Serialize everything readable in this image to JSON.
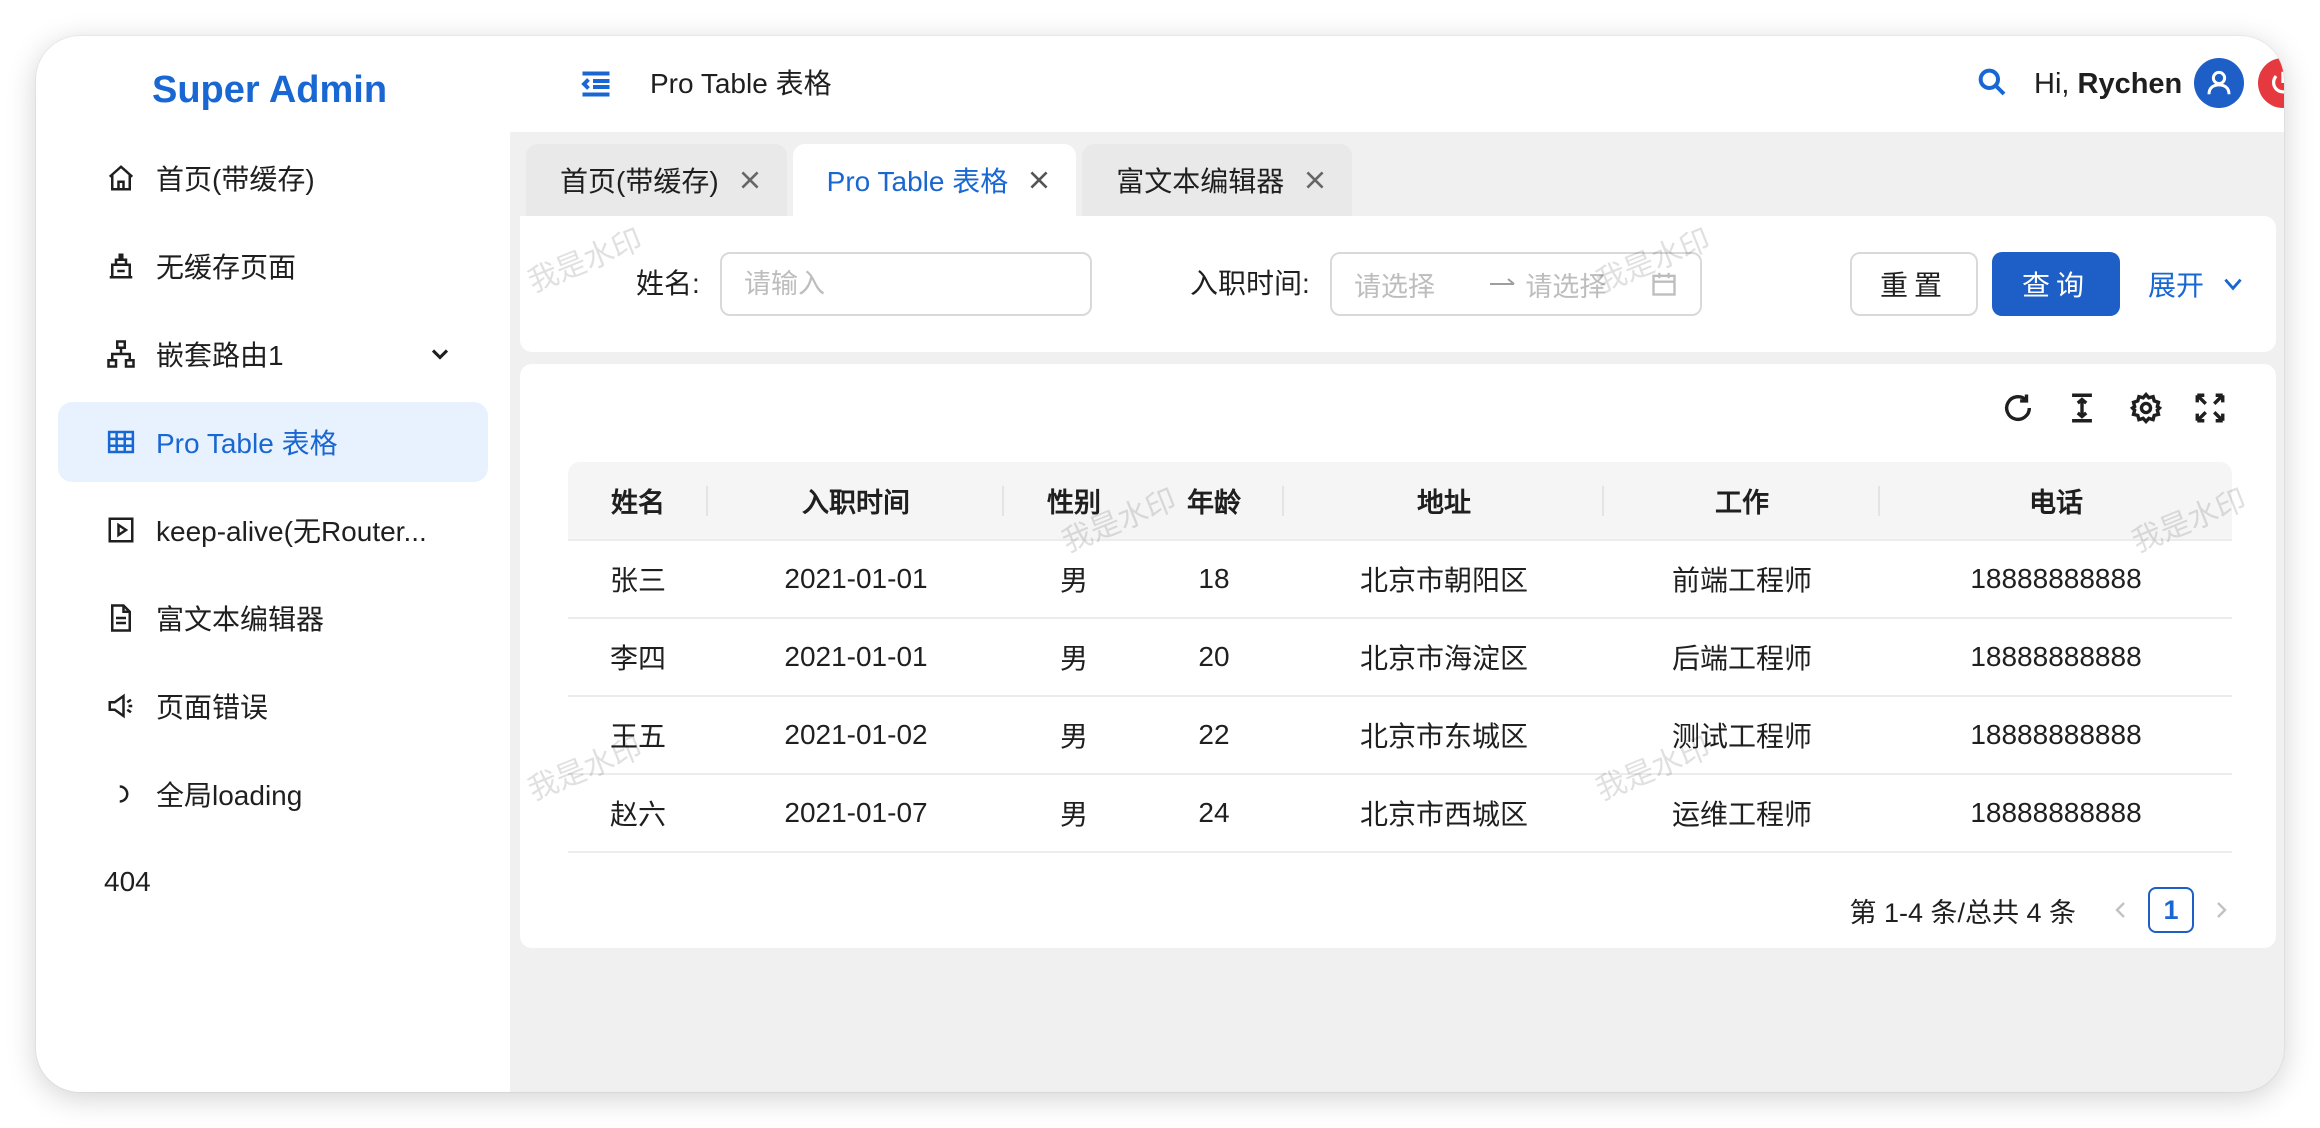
{
  "app": {
    "logo": "Super Admin"
  },
  "sidebar": {
    "items": [
      {
        "label": "首页(带缓存)",
        "icon": "home-icon"
      },
      {
        "label": "无缓存页面",
        "icon": "factory-icon"
      },
      {
        "label": "嵌套路由1",
        "icon": "sitemap-icon",
        "has_children": true
      },
      {
        "label": "Pro Table 表格",
        "icon": "table-icon",
        "active": true
      },
      {
        "label": "keep-alive(无Router...",
        "icon": "play-square-icon"
      },
      {
        "label": "富文本编辑器",
        "icon": "document-icon"
      },
      {
        "label": "页面错误",
        "icon": "sound-icon"
      },
      {
        "label": "全局loading",
        "icon": "loading-icon"
      },
      {
        "label": "404"
      }
    ]
  },
  "header": {
    "title": "Pro Table 表格",
    "greeting_prefix": "Hi,",
    "user_name": "Rychen"
  },
  "tabs": [
    {
      "label": "首页(带缓存)",
      "active": false
    },
    {
      "label": "Pro Table 表格",
      "active": true
    },
    {
      "label": "富文本编辑器",
      "active": false
    }
  ],
  "search_form": {
    "name_label": "姓名:",
    "name_placeholder": "请输入",
    "date_label": "入职时间:",
    "date_start_placeholder": "请选择",
    "date_end_placeholder": "请选择",
    "reset_label": "重置",
    "query_label": "查询",
    "expand_label": "展开"
  },
  "table": {
    "columns": [
      "姓名",
      "入职时间",
      "性别",
      "年龄",
      "地址",
      "工作",
      "电话"
    ],
    "rows": [
      [
        "张三",
        "2021-01-01",
        "男",
        "18",
        "北京市朝阳区",
        "前端工程师",
        "18888888888"
      ],
      [
        "李四",
        "2021-01-01",
        "男",
        "20",
        "北京市海淀区",
        "后端工程师",
        "18888888888"
      ],
      [
        "王五",
        "2021-01-02",
        "男",
        "22",
        "北京市东城区",
        "测试工程师",
        "18888888888"
      ],
      [
        "赵六",
        "2021-01-07",
        "男",
        "24",
        "北京市西城区",
        "运维工程师",
        "18888888888"
      ]
    ]
  },
  "pagination": {
    "total_text": "第 1-4 条/总共 4 条",
    "current_page": "1"
  },
  "watermark": "我是水印",
  "colors": {
    "primary": "#1d5fc6",
    "active_bg": "#e8f2fe",
    "danger": "#e5393f"
  }
}
